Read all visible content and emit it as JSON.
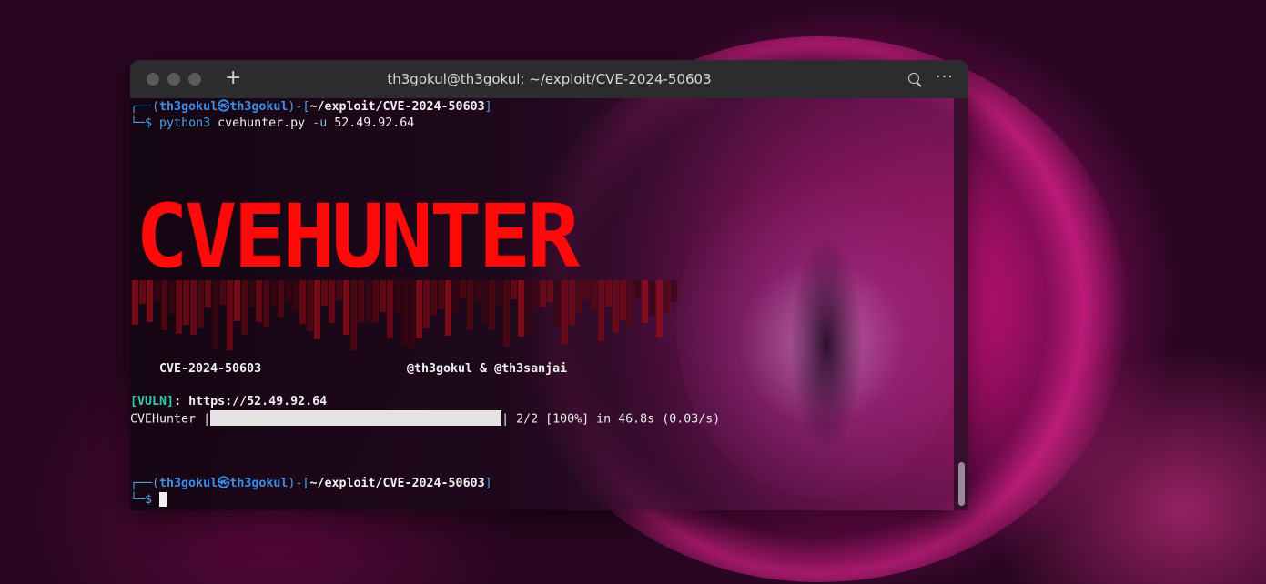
{
  "window": {
    "title": "th3gokul@th3gokul: ~/exploit/CVE-2024-50603",
    "new_tab_label": "+",
    "menu_label": "···"
  },
  "colors": {
    "banner_red": "#ff0a0a",
    "prompt_blue": "#3d8ee8",
    "vuln_teal": "#34c7b0"
  },
  "prompt1": {
    "frame_open": "┌──(",
    "user": "th3gokul",
    "at": "㉿",
    "host": "th3gokul",
    "mid": ")-[",
    "path": "~/exploit/CVE-2024-50603",
    "close": "]",
    "line2_prefix": "└─",
    "dollar": "$",
    "cmd": "python3",
    "script": "cvehunter.py",
    "flag": "-u",
    "target": "52.49.92.64"
  },
  "banner": {
    "text": "CVEHUNTER",
    "cve": "CVE-2024-50603",
    "authors": "@th3gokul & @th3sanjai"
  },
  "result": {
    "vuln_tag": "VULN",
    "url": "https://52.49.92.64",
    "progress_label": "CVEHunter",
    "progress_fraction": 1.0,
    "progress_stats": "2/2 [100%] in 46.8s (0.03/s)"
  },
  "prompt2": {
    "frame_open": "┌──(",
    "user": "th3gokul",
    "at": "㉿",
    "host": "th3gokul",
    "mid": ")-[",
    "path": "~/exploit/CVE-2024-50603",
    "close": "]",
    "line2_prefix": "└─",
    "dollar": "$"
  }
}
